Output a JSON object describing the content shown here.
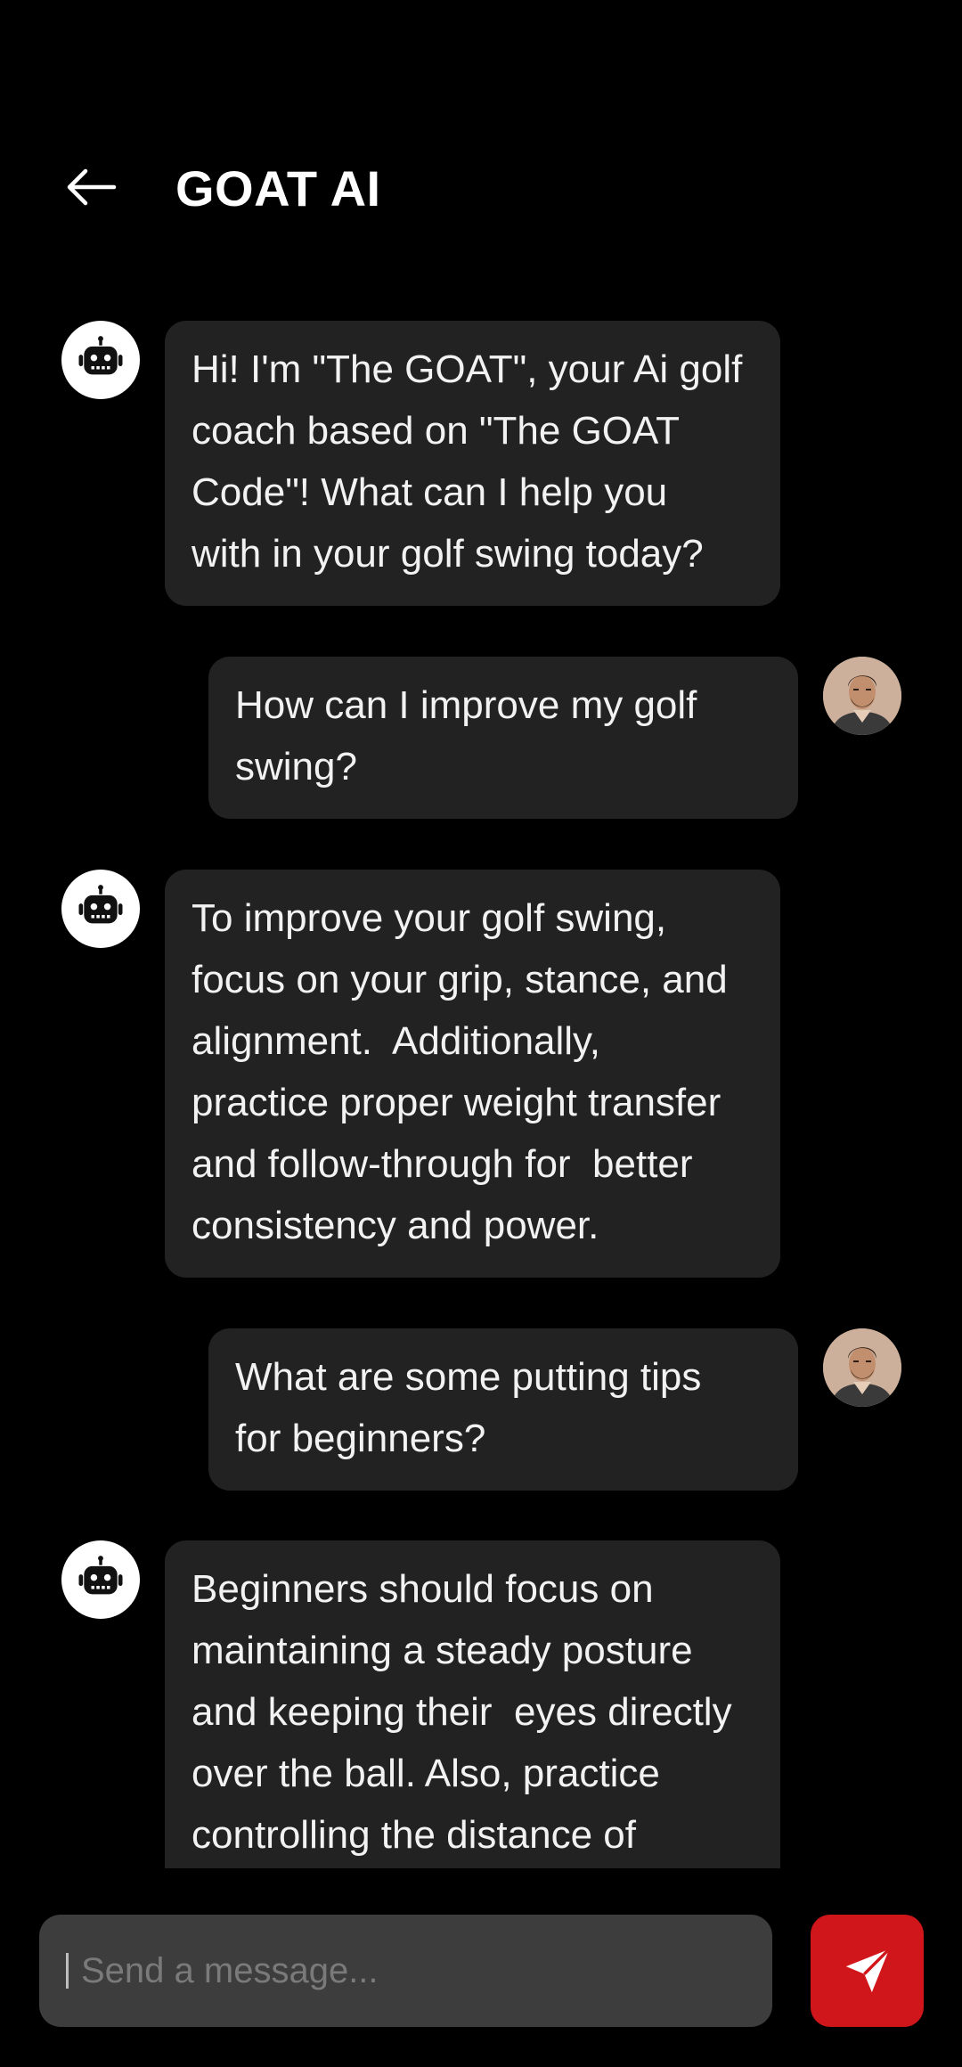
{
  "header": {
    "title": "GOAT AI",
    "back_icon": "arrow-left-icon"
  },
  "messages": [
    {
      "sender": "bot",
      "avatar_icon": "robot-icon",
      "text": "Hi! I'm \"The GOAT\", your Ai golf\ncoach based on \"The GOAT\nCode\"! What can I help you\nwith in your golf swing today?"
    },
    {
      "sender": "user",
      "avatar_icon": "user-avatar",
      "text": "How can I improve my golf\nswing?"
    },
    {
      "sender": "bot",
      "avatar_icon": "robot-icon",
      "text": "To improve your golf swing,\nfocus on your grip, stance, and\nalignment.  Additionally,\npractice proper weight transfer\nand follow-through for  better\nconsistency and power."
    },
    {
      "sender": "user",
      "avatar_icon": "user-avatar",
      "text": "What are some putting tips\nfor beginners?"
    },
    {
      "sender": "bot",
      "avatar_icon": "robot-icon",
      "text": "Beginners should focus on\nmaintaining a steady posture\nand keeping their  eyes directly\nover the ball. Also, practice\ncontrolling the distance of"
    }
  ],
  "composer": {
    "placeholder": "Send a message...",
    "send_icon": "send-icon"
  },
  "colors": {
    "background": "#000000",
    "bubble": "#222222",
    "input": "#3d3d3d",
    "accent": "#d0161a"
  }
}
